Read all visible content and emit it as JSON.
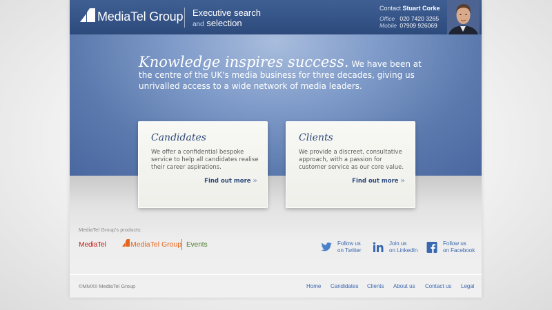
{
  "header": {
    "brand": "MediaTel Group",
    "tagline_line1": "Executive search",
    "tagline_and": "and",
    "tagline_line2": "selection",
    "contact_label": "Contact",
    "contact_name": "Stuart Corke",
    "office_label": "Office",
    "office_number": "020 7420 3265",
    "mobile_label": "Mobile",
    "mobile_number": "07909 926069"
  },
  "hero": {
    "headline": "Knowledge inspires success.",
    "body": "We have been at the centre of the UK's media business for three decades, giving us unrivalled access to a wide network of media leaders."
  },
  "cards": [
    {
      "title": "Candidates",
      "body": "We offer a confidential bespoke service to help all candidates realise their career aspirations.",
      "link": "Find out more"
    },
    {
      "title": "Clients",
      "body": "We provide a discreet, consultative approach, with a passion for customer service as our core value.",
      "link": "Find out more"
    }
  ],
  "products": {
    "label": "MediaTel Group's products:",
    "items": [
      "MediaTel",
      "MediaTel Group",
      "Events"
    ]
  },
  "social": [
    {
      "line1": "Follow us",
      "line2": "on Twitter",
      "icon": "twitter-icon"
    },
    {
      "line1": "Join us",
      "line2": "on LinkedIn",
      "icon": "linkedin-icon"
    },
    {
      "line1": "Follow us",
      "line2": "on Facebook",
      "icon": "facebook-icon"
    }
  ],
  "footer": {
    "copyright": "©MMXII MediaTel Group",
    "nav": [
      "Home",
      "Candidates",
      "Clients",
      "About us",
      "Contact us",
      "Legal"
    ]
  },
  "colors": {
    "header_blue": "#2d4a7b",
    "hero_blue": "#5b79ad",
    "link_blue": "#3a68b0",
    "mediatel_red": "#c8241c",
    "group_orange": "#e5661c",
    "events_green": "#4f7d2a"
  }
}
